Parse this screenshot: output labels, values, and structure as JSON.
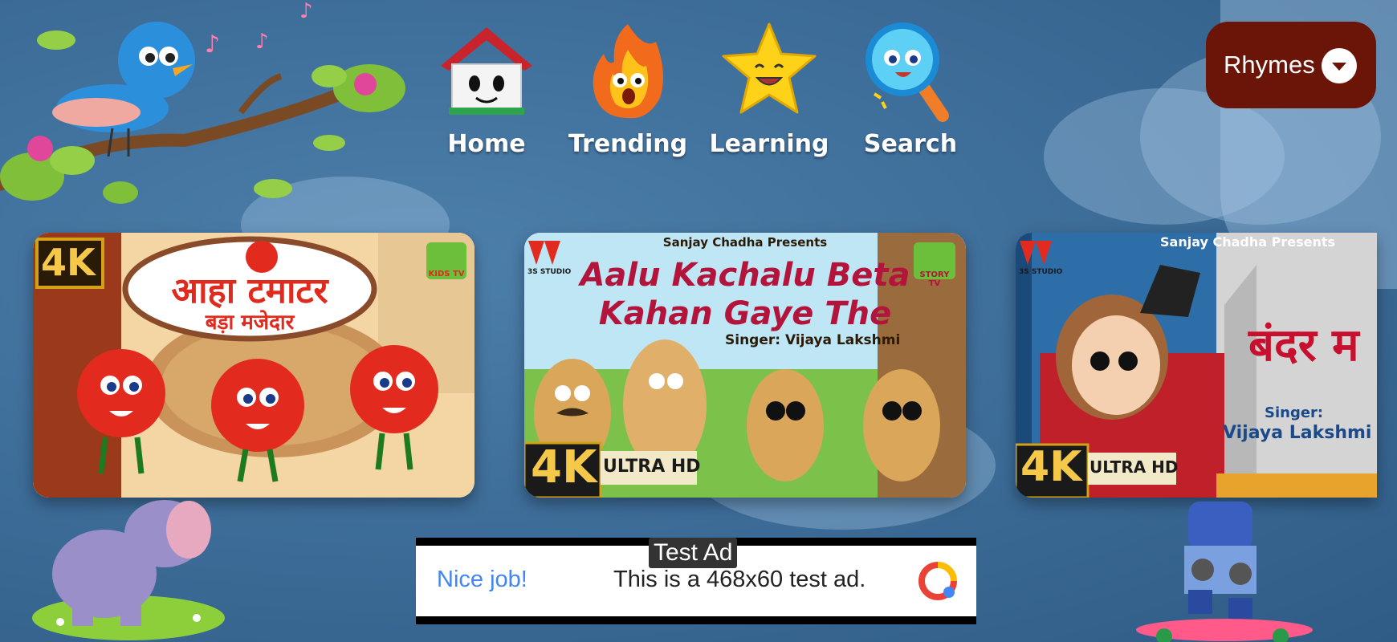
{
  "nav": [
    {
      "label": "Home",
      "icon": "house-icon"
    },
    {
      "label": "Trending",
      "icon": "fire-icon"
    },
    {
      "label": "Learning",
      "icon": "star-icon"
    },
    {
      "label": "Search",
      "icon": "magnifier-icon"
    }
  ],
  "dropdown": {
    "label": "Rhymes",
    "icon": "chevron-down-icon"
  },
  "cards": [
    {
      "badge": "4K",
      "hindi_title": "आहा टमाटर",
      "hindi_subtitle": "बड़ा मजेदार",
      "channel_logo": "KIDS TV",
      "accent": "#e02a1e"
    },
    {
      "presenter": "Sanjay Chadha Presents",
      "title_line1": "Aalu Kachalu Beta",
      "title_line2": "Kahan Gaye The",
      "singer": "Singer: Vijaya Lakshmi",
      "badge": "4K",
      "badge_sub": "ULTRA HD",
      "channel_logo": "STORY TV",
      "studio": "3S STUDIO",
      "accent": "#b3143c"
    },
    {
      "presenter": "Sanjay Chadha Presents",
      "hindi_title": "बंदर म",
      "singer_label": "Singer:",
      "singer_name": "Vijaya Lakshmi",
      "badge": "4K",
      "badge_sub": "ULTRA HD",
      "studio": "3S STUDIO",
      "accent": "#c8102e"
    }
  ],
  "ad": {
    "tag": "Test Ad",
    "nice": "Nice job!",
    "text": "This is a 468x60 test ad."
  }
}
